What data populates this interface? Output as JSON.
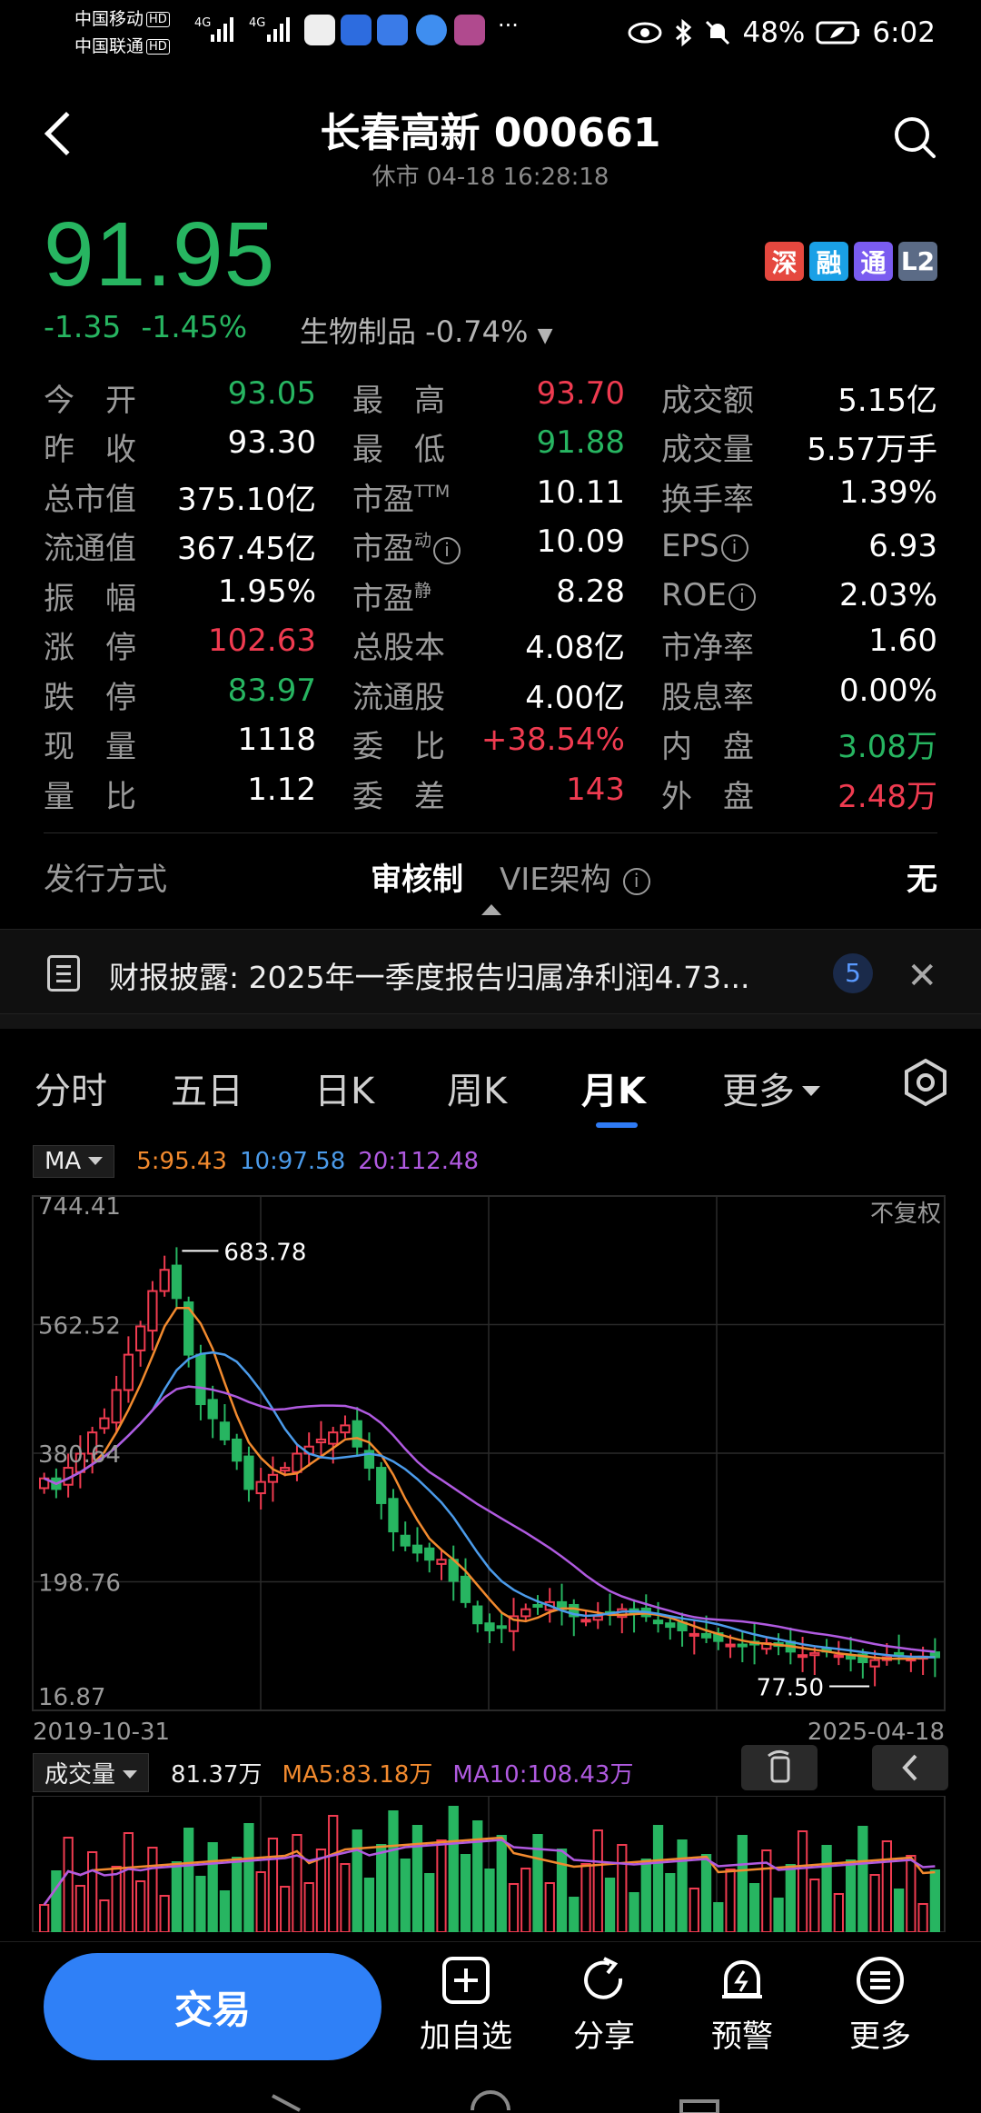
{
  "status": {
    "carrier1": "中国移动",
    "carrier2": "中国联通",
    "hd": "HD",
    "net": "4G",
    "battery": "48%",
    "time": "6:02",
    "more": "···"
  },
  "header": {
    "title": "长春高新 000661",
    "sub": "休市 04-18 16:28:18"
  },
  "quote": {
    "price": "91.95",
    "change": "-1.35",
    "change_pct": "-1.45%",
    "sector": "生物制品 -0.74%",
    "badges": [
      {
        "label": "深",
        "color": "#e5483f"
      },
      {
        "label": "融",
        "color": "#1aa0e6"
      },
      {
        "label": "通",
        "color": "#7a5cf0"
      },
      {
        "label": "L2",
        "color": "#5b6b86"
      }
    ]
  },
  "stats": [
    [
      [
        "今　开",
        "93.05",
        "green"
      ],
      [
        "最　高",
        "93.70",
        "red"
      ],
      [
        "成交额",
        "5.15亿",
        "white"
      ]
    ],
    [
      [
        "昨　收",
        "93.30",
        "white"
      ],
      [
        "最　低",
        "91.88",
        "green"
      ],
      [
        "成交量",
        "5.57万手",
        "white"
      ]
    ],
    [
      [
        "总市值",
        "375.10亿",
        "white"
      ],
      [
        "市盈",
        "10.11",
        "white",
        "TTM"
      ],
      [
        "换手率",
        "1.39%",
        "white"
      ]
    ],
    [
      [
        "流通值",
        "367.45亿",
        "white"
      ],
      [
        "市盈",
        "10.09",
        "white",
        "动",
        "i"
      ],
      [
        "EPS",
        "6.93",
        "white",
        "",
        "i"
      ]
    ],
    [
      [
        "振　幅",
        "1.95%",
        "white"
      ],
      [
        "市盈",
        "8.28",
        "white",
        "静"
      ],
      [
        "ROE",
        "2.03%",
        "white",
        "",
        "i"
      ]
    ],
    [
      [
        "涨　停",
        "102.63",
        "red"
      ],
      [
        "总股本",
        "4.08亿",
        "white"
      ],
      [
        "市净率",
        "1.60",
        "white"
      ]
    ],
    [
      [
        "跌　停",
        "83.97",
        "green"
      ],
      [
        "流通股",
        "4.00亿",
        "white"
      ],
      [
        "股息率",
        "0.00%",
        "white"
      ]
    ],
    [
      [
        "现　量",
        "1118",
        "white"
      ],
      [
        "委　比",
        "+38.54%",
        "red"
      ],
      [
        "内　盘",
        "3.08万",
        "green"
      ]
    ],
    [
      [
        "量　比",
        "1.12",
        "white"
      ],
      [
        "委　差",
        "143",
        "red"
      ],
      [
        "外　盘",
        "2.48万",
        "red"
      ]
    ]
  ],
  "issue": {
    "label": "发行方式",
    "current": "审核制",
    "vie": "VIE架构",
    "vie_value": "无"
  },
  "news": {
    "text": "财报披露: 2025年一季度报告归属净利润4.73...",
    "count": "5"
  },
  "tabs": [
    "分时",
    "五日",
    "日K",
    "周K",
    "月K",
    "更多"
  ],
  "active_tab": "月K",
  "ma": {
    "button": "MA",
    "ma5": "5:95.43",
    "ma10": "10:97.58",
    "ma20": "20:112.48"
  },
  "chart_data": {
    "type": "candlestick",
    "adjust": "不复权",
    "y_labels": [
      "744.41",
      "562.52",
      "380.64",
      "198.76",
      "16.87"
    ],
    "ylim": [
      16.87,
      744.41
    ],
    "x_start": "2019-10-31",
    "x_end": "2025-04-18",
    "high_label": "683.78",
    "low_label": "77.50",
    "closes": [
      345,
      330,
      360,
      380,
      410,
      430,
      470,
      520,
      560,
      610,
      640,
      600,
      520,
      450,
      430,
      400,
      370,
      330,
      340,
      350,
      360,
      380,
      390,
      400,
      410,
      420,
      390,
      360,
      310,
      270,
      250,
      240,
      230,
      230,
      200,
      170,
      140,
      130,
      135,
      150,
      160,
      165,
      170,
      160,
      150,
      145,
      150,
      155,
      160,
      155,
      150,
      140,
      135,
      130,
      125,
      120,
      115,
      110,
      108,
      110,
      112,
      108,
      100,
      95,
      98,
      100,
      95,
      90,
      85,
      88,
      92,
      95,
      90,
      93,
      92
    ],
    "series": [
      {
        "name": "MA5",
        "color": "#f28a2e"
      },
      {
        "name": "MA10",
        "color": "#4b9bea"
      },
      {
        "name": "MA20",
        "color": "#b05ae0"
      }
    ]
  },
  "volume": {
    "button": "成交量",
    "value": "81.37万",
    "ma5": "MA5:83.18万",
    "ma10": "MA10:108.43万"
  },
  "bottom": {
    "trade": "交易",
    "items": [
      "加自选",
      "分享",
      "预警",
      "更多"
    ]
  }
}
